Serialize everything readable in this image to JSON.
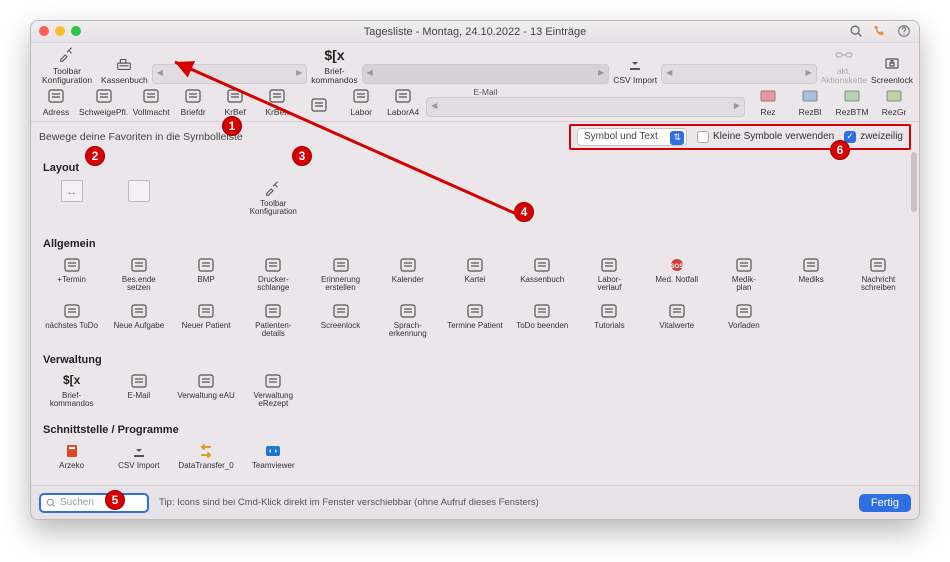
{
  "window": {
    "title": "Tagesliste - Montag, 24.10.2022 - 13 Einträge"
  },
  "titlebar_icons": {
    "search": "search-icon",
    "phone": "phone-icon",
    "help": "help-icon"
  },
  "toolbar_row1": {
    "config": {
      "label": "Toolbar Konfiguration"
    },
    "kassen": {
      "label": "Kassenbuch"
    },
    "brief": {
      "label": "Brief-\nkommandos",
      "glyph": "$[x"
    },
    "email_label": "E-Mail",
    "csv": {
      "label": "CSV Import"
    },
    "akt": {
      "label": "akt.\nAktionskette"
    },
    "lock": {
      "label": "Screenlock"
    }
  },
  "toolbar_row2": {
    "items": [
      {
        "label": "Adress"
      },
      {
        "label": "SchweigePfl."
      },
      {
        "label": "Vollmacht"
      },
      {
        "label": "Briefdr"
      },
      {
        "label": "KrBef"
      },
      {
        "label": "KrBeh"
      },
      {
        "label": ""
      },
      {
        "label": "Labor"
      },
      {
        "label": "LaborA4"
      }
    ],
    "rez": [
      {
        "label": "Rez"
      },
      {
        "label": "RezBl"
      },
      {
        "label": "RezBTM"
      },
      {
        "label": "RezGr"
      }
    ]
  },
  "band": {
    "instruction": "Bewege deine Favoriten in die Symbolleiste",
    "display_select": "Symbol und Text",
    "small_icons_label": "Kleine Symbole verwenden",
    "small_icons_checked": false,
    "twoline_label": "zweizeilig",
    "twoline_checked": true
  },
  "sections": {
    "layout": {
      "title": "Layout",
      "items": [
        {
          "label": "",
          "icon": "flex-arrows"
        },
        {
          "label": "",
          "icon": "square"
        },
        {
          "label": "Toolbar Konfiguration",
          "icon": "tools"
        }
      ]
    },
    "allgemein": {
      "title": "Allgemein",
      "rows": [
        [
          {
            "label": "+Termin"
          },
          {
            "label": "Bes.ende setzen"
          },
          {
            "label": "BMP"
          },
          {
            "label": "Drucker-\nschlange"
          },
          {
            "label": "Erinnerung erstellen"
          },
          {
            "label": "Kalender"
          },
          {
            "label": "Kartei"
          },
          {
            "label": "Kassenbuch"
          },
          {
            "label": "Labor-\nverlauf"
          },
          {
            "label": "Med. Notfall"
          },
          {
            "label": "Medik-\nplan"
          },
          {
            "label": "Mediks"
          },
          {
            "label": "Nachricht schreiben"
          }
        ],
        [
          {
            "label": "nächstes ToDo"
          },
          {
            "label": "Neue Aufgabe"
          },
          {
            "label": "Neuer Patient"
          },
          {
            "label": "Patienten-\ndetails"
          },
          {
            "label": "Screenlock"
          },
          {
            "label": "Sprach-\nerkennung"
          },
          {
            "label": "Termine Patient"
          },
          {
            "label": "ToDo beenden"
          },
          {
            "label": "Tutorials"
          },
          {
            "label": "Vitalwerte"
          },
          {
            "label": "Vorladen"
          }
        ]
      ]
    },
    "verwaltung": {
      "title": "Verwaltung",
      "items": [
        {
          "label": "Brief-\nkommandos"
        },
        {
          "label": "E-Mail"
        },
        {
          "label": "Verwaltung eAU"
        },
        {
          "label": "Verwaltung eRezept"
        }
      ]
    },
    "schnittstelle": {
      "title": "Schnittstelle / Programme",
      "items": [
        {
          "label": "Arzeko"
        },
        {
          "label": "CSV Import"
        },
        {
          "label": "DataTransfer_0"
        },
        {
          "label": "Teamviewer"
        }
      ]
    }
  },
  "footer": {
    "search_placeholder": "Suchen",
    "tip": "Tip: Icons sind bei Cmd-Klick direkt im Fenster verschiebbar (ohne Aufruf dieses Fensters)",
    "done": "Fertig"
  },
  "annotations": {
    "markers": [
      "1",
      "2",
      "3",
      "4",
      "5",
      "6"
    ]
  }
}
